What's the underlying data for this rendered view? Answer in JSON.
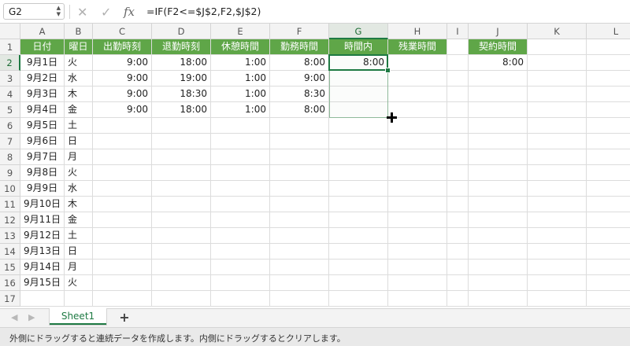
{
  "formula_bar": {
    "name_box": "G2",
    "cancel_icon": "✕",
    "confirm_icon": "✓",
    "fx_label": "fx",
    "formula": "=IF(F2<=$J$2,F2,$J$2)"
  },
  "columns": [
    "A",
    "B",
    "C",
    "D",
    "E",
    "F",
    "G",
    "H",
    "I",
    "J",
    "K",
    "L"
  ],
  "rows": [
    "1",
    "2",
    "3",
    "4",
    "5",
    "6",
    "7",
    "8",
    "9",
    "10",
    "11",
    "12",
    "13",
    "14",
    "15",
    "16",
    "17"
  ],
  "header_row": {
    "A": "日付",
    "B": "曜日",
    "C": "出勤時刻",
    "D": "退勤時刻",
    "E": "休憩時間",
    "F": "勤務時間",
    "G": "時間内",
    "H": "残業時間",
    "J": "契約時間"
  },
  "data_rows": [
    {
      "A": "9月1日",
      "B": "火",
      "C": "9:00",
      "D": "18:00",
      "E": "1:00",
      "F": "8:00",
      "G": "8:00",
      "J": "8:00"
    },
    {
      "A": "9月2日",
      "B": "水",
      "C": "9:00",
      "D": "19:00",
      "E": "1:00",
      "F": "9:00",
      "G": "",
      "J": ""
    },
    {
      "A": "9月3日",
      "B": "木",
      "C": "9:00",
      "D": "18:30",
      "E": "1:00",
      "F": "8:30",
      "G": "",
      "J": ""
    },
    {
      "A": "9月4日",
      "B": "金",
      "C": "9:00",
      "D": "18:00",
      "E": "1:00",
      "F": "8:00",
      "G": "",
      "J": ""
    },
    {
      "A": "9月5日",
      "B": "土"
    },
    {
      "A": "9月6日",
      "B": "日"
    },
    {
      "A": "9月7日",
      "B": "月"
    },
    {
      "A": "9月8日",
      "B": "火"
    },
    {
      "A": "9月9日",
      "B": "水"
    },
    {
      "A": "9月10日",
      "B": "木"
    },
    {
      "A": "9月11日",
      "B": "金"
    },
    {
      "A": "9月12日",
      "B": "土"
    },
    {
      "A": "9月13日",
      "B": "日"
    },
    {
      "A": "9月14日",
      "B": "月"
    },
    {
      "A": "9月15日",
      "B": "火"
    }
  ],
  "tabs": {
    "prev_icon": "◀",
    "next_icon": "▶",
    "sheet_name": "Sheet1",
    "add_label": "+"
  },
  "status_bar": {
    "message": "外側にドラッグすると連続データを作成します。内側にドラッグするとクリアします。"
  },
  "colors": {
    "header_fill": "#5fa648",
    "accent": "#1e7a43"
  }
}
